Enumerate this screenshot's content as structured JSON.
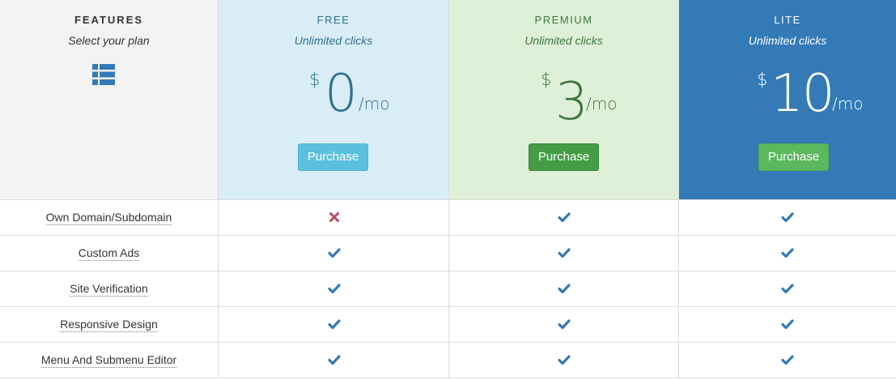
{
  "header": {
    "features": {
      "title": "FEATURES",
      "subtitle": "Select your plan",
      "icon": "list-icon"
    },
    "plans": [
      {
        "key": "free",
        "name": "FREE",
        "subtitle": "Unlimited clicks",
        "currency": "$",
        "amount": "0",
        "period": "/mo",
        "button": "Purchase"
      },
      {
        "key": "premium",
        "name": "PREMIUM",
        "subtitle": "Unlimited clicks",
        "currency": "$",
        "amount": "3",
        "period": "/mo",
        "button": "Purchase"
      },
      {
        "key": "lite",
        "name": "LITE",
        "subtitle": "Unlimited clicks",
        "currency": "$",
        "amount": "10",
        "period": "/mo",
        "button": "Purchase"
      }
    ]
  },
  "features": [
    {
      "label": "Own Domain/Subdomain",
      "free": "cross-icon",
      "premium": "check-icon",
      "lite": "check-icon"
    },
    {
      "label": "Custom Ads",
      "free": "check-icon",
      "premium": "check-icon",
      "lite": "check-icon"
    },
    {
      "label": "Site Verification",
      "free": "check-icon",
      "premium": "check-icon",
      "lite": "check-icon"
    },
    {
      "label": "Responsive Design",
      "free": "check-icon",
      "premium": "check-icon",
      "lite": "check-icon"
    },
    {
      "label": "Menu And Submenu Editor",
      "free": "check-icon",
      "premium": "check-icon",
      "lite": "check-icon"
    }
  ],
  "colors": {
    "free_bg": "#d9edf7",
    "free_text": "#31708f",
    "premium_bg": "#dff0d8",
    "premium_text": "#3c763d",
    "lite_bg": "#337ab7",
    "lite_text": "#ffffff",
    "features_bg": "#f3f3f3",
    "check": "#337ab7",
    "cross": "#b94a5c"
  }
}
